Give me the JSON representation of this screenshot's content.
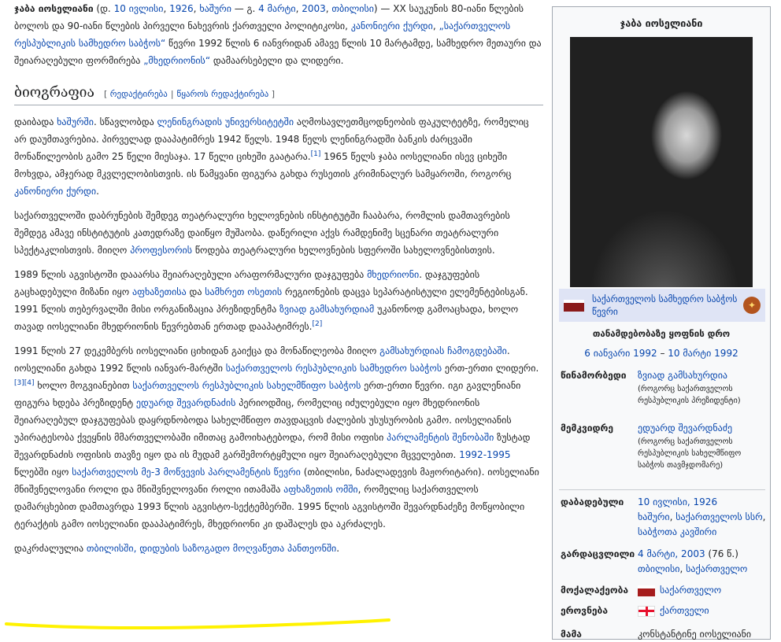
{
  "lead": {
    "name": "ჯაბა იოსელიანი",
    "born_open": " (დ. ",
    "born_date": "10 ივლისი",
    "c1": ", ",
    "born_year": "1926",
    "c2": ", ",
    "born_place": "ხაშური",
    "dash": " — გ. ",
    "died_date": "4 მარტი",
    "c3": ", ",
    "died_year": "2003",
    "c4": ", ",
    "died_place": "თბილისი",
    "close": ") — XX საუკუნის 80-იანი წლების ბოლოს და 90-იანი წლების პირველი ნახევრის ქართველი პოლიტიკოსი, ",
    "thief": "კანონიერი ქურდი",
    "c5": ", ",
    "council": "„საქართველოს რესპუბლიკის სამხედრო საბჭოს“",
    "rest": " წევრი 1992 წლის 6 იანვრიდან ამავე წლის 10 მარტამდე, სამხედრო მეთაური და შეიარაღებული ფორმირება ",
    "mkhedrioni": "„მხედრიონის“",
    "end": " დამაარსებელი და ლიდერი."
  },
  "section": {
    "title": "ბიოგრაფია",
    "open": "[ ",
    "edit": "რედაქტირება",
    "sep": "|",
    "edit_source": "წყაროს რედაქტირება",
    "close": " ]"
  },
  "p1": {
    "a": "დაიბადა ",
    "khashuri": "ხაშურში",
    "b": ". სწავლობდა ",
    "university": "ლენინგრადის უნივერსიტეტში",
    "c": " აღმოსავლეთმცოდნეობის ფაკულტეტზე, რომელიც არ დაუმთავრებია. პირველად დააპატიმრეს 1942 წელს. 1948 წელს ლენინგრადში ბანკის ძარცვაში მონაწილეობის გამო 25 წელი მიესაჯა. 17 წელი ციხეში გაატარა.",
    "ref1": "[1]",
    "d": " 1965 წელს ჯაბა იოსელიანი ისევ ციხეში მოხვდა, ამჯერად მკვლელობისთვის. ის წამყვანი ფიგურა გახდა რუსეთის კრიმინალურ სამყაროში, როგორც ",
    "thief": "კანონიერი ქურდი",
    "e": "."
  },
  "p2": {
    "a": "საქართველოში დაბრუნების შემდეგ თეატრალური ხელოვნების ინსტიტუტში ჩააბარა, რომლის დამთავრების შემდეგ ამავე ინსტიტუტის კათედრაზე დაიწყო მუშაობა. დაწერილი აქვს რამდენიმე სცენარი თეატრალური სპექტაკლისთვის. მიიღო ",
    "professor": "პროფესორის",
    "b": " წოდება თეატრალური ხელოვნების სფეროში სახელოვნებისთვის."
  },
  "p3": {
    "a": "1989 წლის აგვისტოში დააარსა შეიარაღებული არაფორმალური დაჯგუფება ",
    "mkhedrioni": "მხედრიონი",
    "b": ". დაჯგუფების გაცხადებული მიზანი იყო ",
    "abkhazia": "აფხაზეთისა",
    "c": " და ",
    "samachablo": "სამხრეთ ოსეთის",
    "d": " რეგიონების დაცვა სეპარატისტული ელემენტებისგან. 1991 წლის თებერვალში მისი ორგანიზაცია პრეზიდენტმა ",
    "zviad": "ზვიად გამსახურდიამ",
    "e": " უკანონოდ გამოაცხადა, ხოლო თავად იოსელიანი მხედრიონის წევრებთან ერთად დააპატიმრეს.",
    "ref2": "[2]"
  },
  "p4": {
    "a": "1991 წლის 27 დეკემბერს იოსელიანი ციხიდან გაიქცა და მონაწილეობა მიიღო ",
    "coup": "გამსახურდიას ჩამოგდებაში",
    "b": ". იოსელიანი გახდა 1992 წლის იანვარ-მარტში ",
    "council": "საქართველოს რესპუბლიკის სამხედრო საბჭოს",
    "c": " ერთ-ერთი ლიდერი.",
    "ref34": "[3][4]",
    "d": " ხოლო მოგვიანებით ",
    "statecouncil": "საქართველოს რესპუბლიკის სახელმწიფო საბჭოს",
    "e": " ერთ-ერთი წევრი. იგი გავლენიანი ფიგურა ხდება პრეზიდენტ ",
    "shevardnadze": "ედუარდ შევარდნაძის",
    "f": " პერიოდშიც, რომელიც იძულებული იყო მხედრიონის შეიარაღებულ დაჯგუფებას დაყრდნობოდა სახელმწიფო თავდაცვის ძალების უსუსურობის გამო. იოსელიანის უპირატესობა ქვეყნის მმართველობაში იმითაც გამოიხატებოდა, რომ მისი ოფისი ",
    "parliament": "პარლამენტის შენობაში",
    "g": " ზუსტად შევარდნაძის ოფისის თავზე იყო და ის მუდამ გარშემორტყმული იყო შეიარაღებული მცველებით. ",
    "years": "1992-1995",
    "h": " წლებში იყო ",
    "convocation": "საქართველოს მე-3 მოწვევის პარლამენტის წევრი",
    "i": " (თბილისი, ნაძალადევის მაჟორიტარი). იოსელიანი მნიშვნელოვანი როლი და მნიშვნელოვანი როლი ითამაშა ",
    "war": "აფხაზეთის ომში",
    "j": ", რომელიც საქართველოს დამარცხებით დამთავრდა 1993 წლის აგვისტო-სექტემბერში. 1995 წლის აგვისტოში შევარდნაძეზე მოწყობილი ტერაქტის გამო იოსელიანი დააპატიმრეს, მხედრიონი კი დაშალეს და აკრძალეს."
  },
  "p5": {
    "a": "დაკრძალულია ",
    "pantheon": "თბილისში, დიდუბის საზოგადო მოღვაწეთა პანთეონში",
    "b": "."
  },
  "infobox": {
    "title": "ჯაბა იოსელიანი",
    "caption": "საქართველოს სამხედრო საბჭოს წევრი",
    "term_label": "თანამდებობაზე ყოფნის დრო",
    "term_start": "6 იანვარი 1992",
    "term_dash": " – ",
    "term_end": "10 მარტი 1992",
    "pred_label": "წინამორბედი",
    "pred_name": "ზვიად გამსახურდია",
    "pred_note": "(როგორც საქართველოს რესპუბლიკის პრეზიდენტი)",
    "succ_label": "მემკვიდრე",
    "succ_name": "ედუარდ შევარდნაძე",
    "succ_note": "(როგორც საქართველოს რესპუბლიკის სახელმწიფო საბჭოს თავმჯდომარე)",
    "born_label": "დაბადებული",
    "born_date": "10 ივლისი, 1926",
    "born_place1": "ხაშური",
    "born_comma": ", ",
    "born_place2": "საქართველოს სსრ",
    "born_place3": "საბჭოთა კავშირი",
    "died_label": "გარდაცვლილი",
    "died_date": "4 მარტი, 2003",
    "died_age": " (76 წ.)",
    "died_place1": "თბილისი",
    "died_place2": "საქართველო",
    "citizen_label": "მოქალაქეობა",
    "citizen_value": "საქართველო",
    "ethnic_label": "ეროვნება",
    "ethnic_value": "ქართველი",
    "last_label": "მამა",
    "last_value": "კონსტანტინე იოსელიანი"
  }
}
